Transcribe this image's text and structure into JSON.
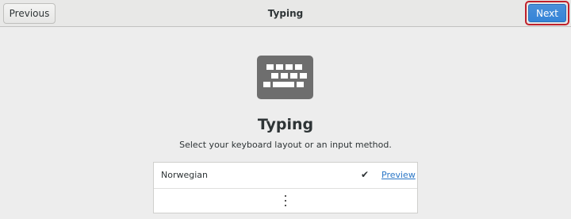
{
  "header": {
    "title": "Typing",
    "previous_label": "Previous",
    "next_label": "Next"
  },
  "main": {
    "icon": "keyboard-icon",
    "heading": "Typing",
    "subtitle": "Select your keyboard layout or an input method.",
    "layouts": [
      {
        "label": "Norwegian",
        "selected": true,
        "preview_label": "Preview"
      }
    ],
    "more_icon": "vertical-ellipsis-icon"
  },
  "colors": {
    "accent": "#3584d8",
    "highlight_border": "#c0202a",
    "link": "#2a76c6",
    "icon_gray": "#6e6e6e"
  }
}
